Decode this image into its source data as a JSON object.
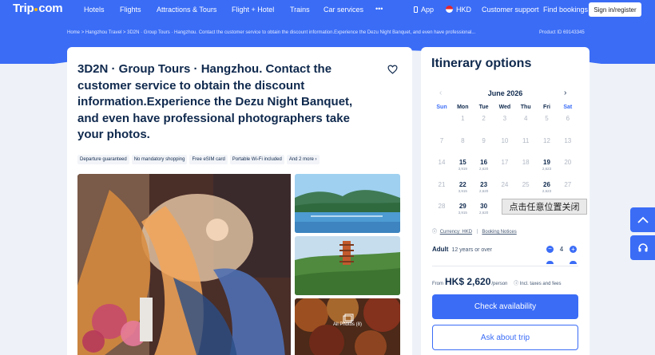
{
  "nav": {
    "logo": "Trip",
    "logo_suffix": "com",
    "items": [
      "Hotels",
      "Flights",
      "Attractions & Tours",
      "Flight + Hotel",
      "Trains",
      "Car services"
    ],
    "more": "•••",
    "app": "App",
    "currency": "HKD",
    "support": "Customer support",
    "bookings": "Find bookings",
    "signin": "Sign in/register"
  },
  "breadcrumb": {
    "home": "Home",
    "travel": "Hangzhou Travel",
    "current": "3D2N · Group Tours · Hangzhou. Contact the customer service to obtain the discount information.Experience the Dezu Night Banquet, and even have professional...",
    "sep": ">"
  },
  "product_id": "Product ID 69143345",
  "product": {
    "title": "3D2N · Group Tours · Hangzhou. Contact the customer service to obtain the discount information.Experience the Dezu Night Banquet, and even have professional photographers take your photos.",
    "tags": [
      "Departure guaranteed",
      "No mandatory shopping",
      "Free eSIM card",
      "Portable Wi-Fi included",
      "And 2 more"
    ],
    "all_photos": "All Photos (8)"
  },
  "itinerary": {
    "title": "Itinerary options",
    "month": "June 2026",
    "weekdays": [
      "Sun",
      "Mon",
      "Tue",
      "Wed",
      "Thu",
      "Fri",
      "Sat"
    ],
    "weeks": [
      [
        {
          "d": "",
          "p": ""
        },
        {
          "d": "1",
          "p": ""
        },
        {
          "d": "2",
          "p": ""
        },
        {
          "d": "3",
          "p": ""
        },
        {
          "d": "4",
          "p": ""
        },
        {
          "d": "5",
          "p": ""
        },
        {
          "d": "6",
          "p": ""
        }
      ],
      [
        {
          "d": "7",
          "p": ""
        },
        {
          "d": "8",
          "p": ""
        },
        {
          "d": "9",
          "p": ""
        },
        {
          "d": "10",
          "p": ""
        },
        {
          "d": "11",
          "p": ""
        },
        {
          "d": "12",
          "p": ""
        },
        {
          "d": "13",
          "p": ""
        }
      ],
      [
        {
          "d": "14",
          "p": ""
        },
        {
          "d": "15",
          "p": "3,919",
          "a": true
        },
        {
          "d": "16",
          "p": "2,620",
          "a": true
        },
        {
          "d": "17",
          "p": ""
        },
        {
          "d": "18",
          "p": ""
        },
        {
          "d": "19",
          "p": "2,623",
          "a": true
        },
        {
          "d": "20",
          "p": ""
        }
      ],
      [
        {
          "d": "21",
          "p": ""
        },
        {
          "d": "22",
          "p": "3,915",
          "a": true
        },
        {
          "d": "23",
          "p": "2,620",
          "a": true
        },
        {
          "d": "24",
          "p": ""
        },
        {
          "d": "25",
          "p": ""
        },
        {
          "d": "26",
          "p": "2,623",
          "a": true
        },
        {
          "d": "27",
          "p": ""
        }
      ],
      [
        {
          "d": "28",
          "p": ""
        },
        {
          "d": "29",
          "p": "3,915",
          "a": true
        },
        {
          "d": "30",
          "p": "2,620",
          "a": true
        },
        {
          "d": "",
          "p": ""
        },
        {
          "d": "",
          "p": ""
        },
        {
          "d": "",
          "p": ""
        },
        {
          "d": "",
          "p": ""
        }
      ]
    ],
    "popup": "点击任意位置关闭",
    "currency_label": "Currency: HKD",
    "booking_notices": "Booking Notices",
    "adult_label": "Adult",
    "adult_age": "12 years or over",
    "adult_count": "4",
    "price_from": "From",
    "price": "HK$ 2,620",
    "price_unit": "/person",
    "price_note": "Incl. taxes and fees",
    "check_availability": "Check availability",
    "ask_about_trip": "Ask about trip"
  },
  "colors": {
    "brand": "#3a6cf6",
    "text": "#0f294d"
  }
}
